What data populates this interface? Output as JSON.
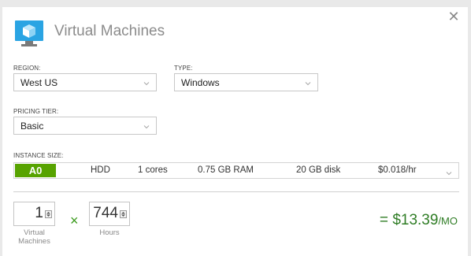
{
  "header": {
    "title": "Virtual Machines",
    "icon": "virtual-machine-icon",
    "close_icon": "close-icon"
  },
  "region": {
    "label": "REGION:",
    "value": "West US"
  },
  "type": {
    "label": "TYPE:",
    "value": "Windows"
  },
  "pricing_tier": {
    "label": "PRICING TIER:",
    "value": "Basic"
  },
  "instance_size": {
    "label": "INSTANCE SIZE:",
    "size": "A0",
    "disk_type": "HDD",
    "cores": "1 cores",
    "ram": "0.75 GB RAM",
    "disk": "20 GB disk",
    "price": "$0.018/hr"
  },
  "quantity": {
    "vm_count": "1",
    "vm_caption_line1": "Virtual",
    "vm_caption_line2": "Machines",
    "times": "×",
    "hours": "744",
    "hours_caption": "Hours"
  },
  "total": {
    "equals": "=",
    "amount": "$13.39",
    "per": "/MO"
  },
  "colors": {
    "accent_green": "#57a300",
    "price_green": "#2f7d25",
    "azure_blue": "#1e9de0"
  }
}
